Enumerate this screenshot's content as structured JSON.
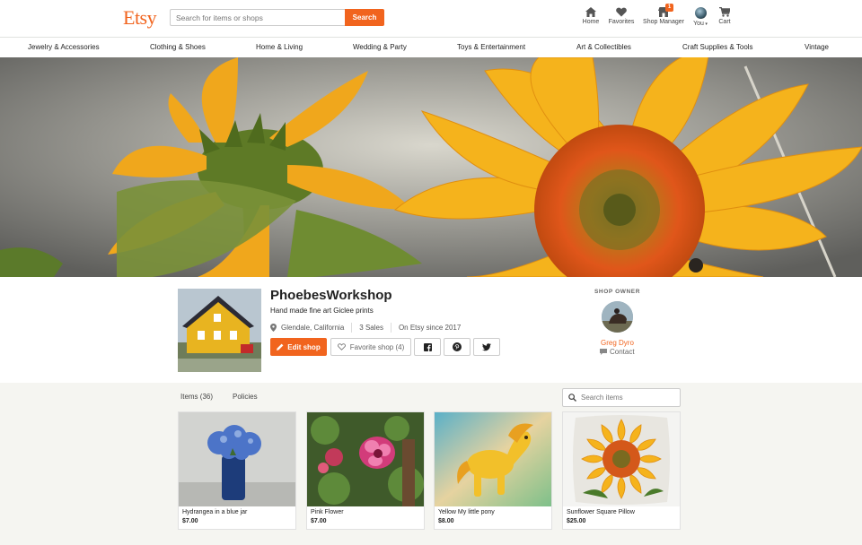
{
  "header": {
    "logo": "Etsy",
    "search_placeholder": "Search for items or shops",
    "search_button": "Search",
    "nav": {
      "home": "Home",
      "favorites": "Favorites",
      "shop_manager": "Shop Manager",
      "shop_manager_badge": "1",
      "you": "You",
      "cart": "Cart"
    }
  },
  "categories": [
    "Jewelry & Accessories",
    "Clothing & Shoes",
    "Home & Living",
    "Wedding & Party",
    "Toys & Entertainment",
    "Art & Collectibles",
    "Craft Supplies & Tools",
    "Vintage"
  ],
  "shop": {
    "name": "PhoebesWorkshop",
    "tagline": "Hand made fine art Giclee prints",
    "location": "Glendale, California",
    "sales": "3 Sales",
    "since": "On Etsy since 2017",
    "edit_button": "Edit shop",
    "favorite_button": "Favorite shop (4)"
  },
  "owner": {
    "label": "SHOP OWNER",
    "name": "Greg Dyro",
    "contact": "Contact"
  },
  "listing": {
    "tabs": [
      "Items (36)",
      "Policies"
    ],
    "search_placeholder": "Search items",
    "items": [
      {
        "title": "Hydrangea in a blue jar",
        "price": "$7.00"
      },
      {
        "title": "Pink Flower",
        "price": "$7.00"
      },
      {
        "title": "Yellow My little pony",
        "price": "$8.00"
      },
      {
        "title": "Sunflower Square Pillow",
        "price": "$25.00"
      }
    ]
  },
  "colors": {
    "brand": "#f1641e",
    "listing_bg": "#f5f5f1"
  }
}
